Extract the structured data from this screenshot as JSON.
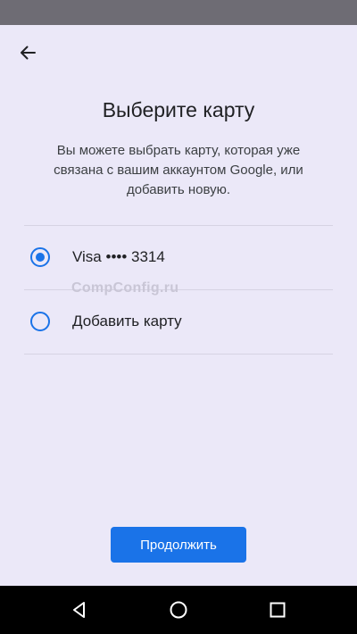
{
  "header": {
    "back_icon": "arrow-back-icon"
  },
  "title": "Выберите карту",
  "subtitle": "Вы можете выбрать карту, которая уже связана с вашим аккаунтом Google, или добавить новую.",
  "options": [
    {
      "label": "Visa •••• 3314",
      "selected": true
    },
    {
      "label": "Добавить карту",
      "selected": false
    }
  ],
  "watermark": "CompConfig.ru",
  "continue_label": "Продолжить",
  "colors": {
    "accent": "#1a73e8",
    "background": "#ebe8f8"
  },
  "nav_bar": {
    "icons": [
      "back-triangle-icon",
      "home-circle-icon",
      "recents-square-icon"
    ]
  }
}
